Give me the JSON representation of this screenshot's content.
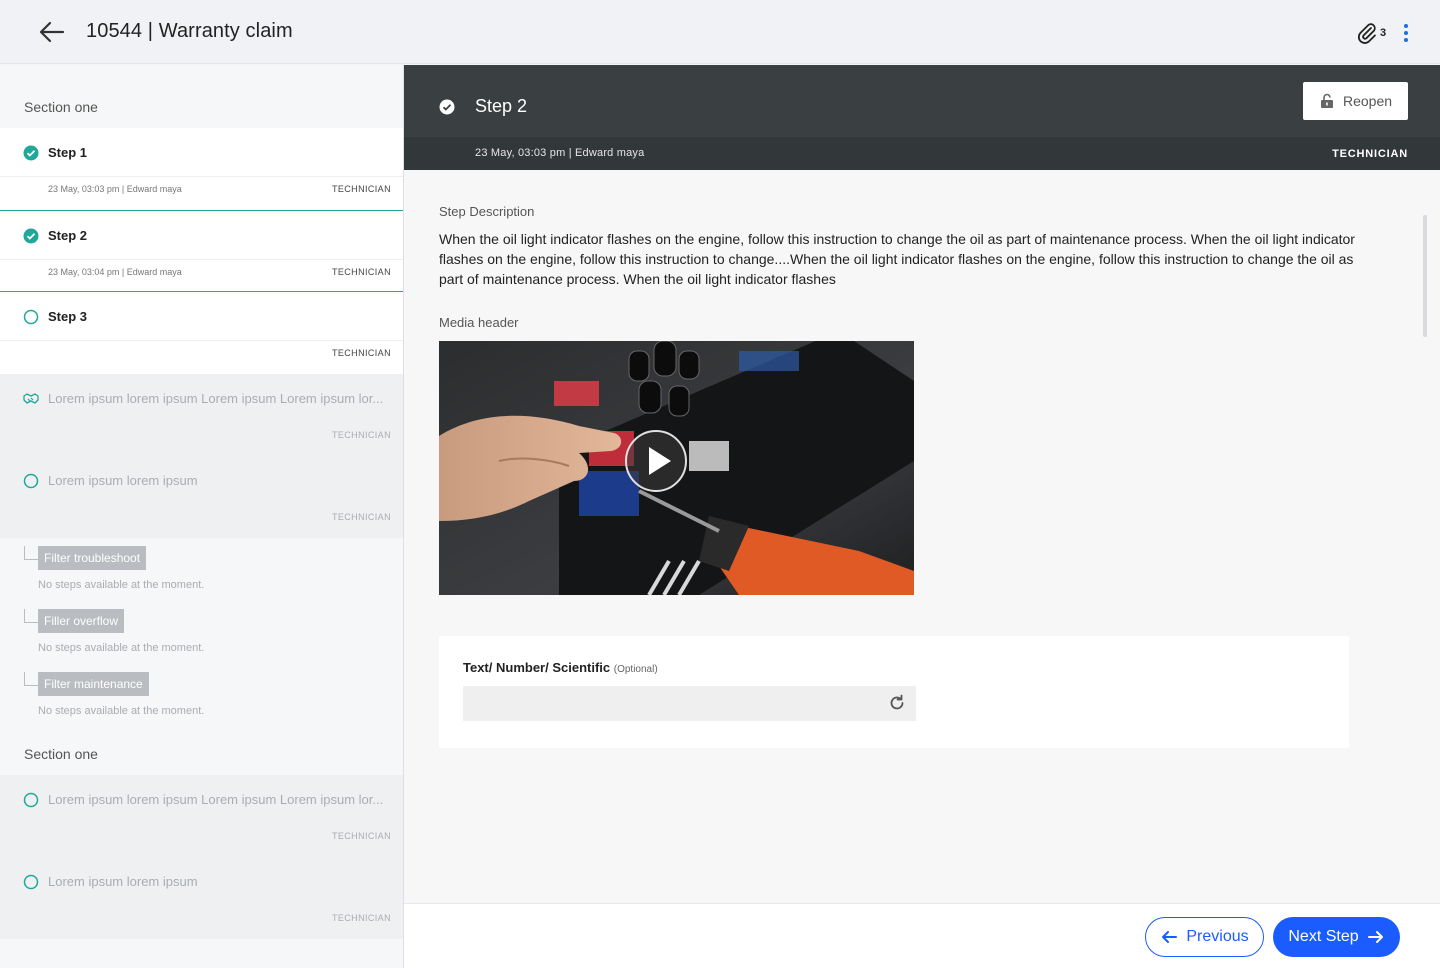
{
  "header": {
    "title": "10544 | Warranty claim",
    "attachment_count": "3"
  },
  "sidebar": {
    "sections": [
      {
        "title": "Section one"
      },
      {
        "title": "Section one"
      }
    ],
    "steps": [
      {
        "label": "Step 1",
        "meta": "23 May, 03:03 pm | Edward maya",
        "role": "TECHNICIAN",
        "status": "done"
      },
      {
        "label": "Step 2",
        "meta": "23 May, 03:04 pm | Edward maya",
        "role": "TECHNICIAN",
        "status": "done"
      },
      {
        "label": "Step 3",
        "meta": "",
        "role": "TECHNICIAN",
        "status": "pending"
      },
      {
        "label": "Lorem ipsum lorem ipsum Lorem ipsum Lorem ipsum lor...",
        "role": "TECHNICIAN",
        "status": "group"
      },
      {
        "label": "Lorem ipsum lorem ipsum",
        "role": "TECHNICIAN",
        "status": "pending"
      },
      {
        "label": "Lorem ipsum lorem ipsum Lorem ipsum Lorem ipsum lor...",
        "role": "TECHNICIAN",
        "status": "pending"
      },
      {
        "label": "Lorem ipsum lorem ipsum",
        "role": "TECHNICIAN",
        "status": "pending"
      }
    ],
    "sub_groups": [
      {
        "label": "Filter troubleshoot",
        "empty": "No steps available at the moment."
      },
      {
        "label": "Filler overflow",
        "empty": "No steps available at the moment."
      },
      {
        "label": "Filter maintenance",
        "empty": "No steps available at the moment."
      }
    ]
  },
  "step": {
    "title": "Step 2",
    "meta": "23 May, 03:03 pm | Edward maya",
    "role": "TECHNICIAN",
    "reopen_label": "Reopen",
    "description_label": "Step Description",
    "description": "When the oil light indicator flashes on the engine, follow this instruction to change the oil as part of maintenance process. When the oil light indicator flashes on the engine, follow this instruction to change....When the oil light indicator flashes on the engine, follow this instruction to change the oil as part of maintenance process. When the oil light indicator flashes",
    "media_label": "Media header",
    "input_label": "Text/ Number/ Scientific",
    "input_optional": "(Optional)",
    "input_value": ""
  },
  "footer": {
    "previous_label": "Previous",
    "next_label": "Next Step"
  },
  "colors": {
    "accent": "#1a5cff",
    "check": "#1fa89a",
    "header_dark": "#3a3f42"
  }
}
